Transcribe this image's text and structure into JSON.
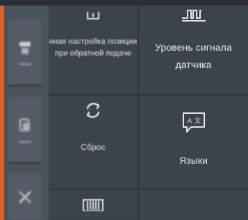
{
  "sidebar": {
    "items": [
      {
        "icon": "settings-icon"
      },
      {
        "icon": "document-icon"
      },
      {
        "icon": "tools-icon"
      }
    ]
  },
  "grid": {
    "tiles": [
      {
        "label": "нная настройка позиции\nпри обратной подаче",
        "icon": "position-adjust-icon"
      },
      {
        "label": "Уровень сигнала\nдатчика",
        "icon": "sensor-signal-icon"
      },
      {
        "label": "Сброс",
        "icon": "reset-icon"
      },
      {
        "label": "Языки",
        "icon": "language-icon"
      }
    ]
  }
}
